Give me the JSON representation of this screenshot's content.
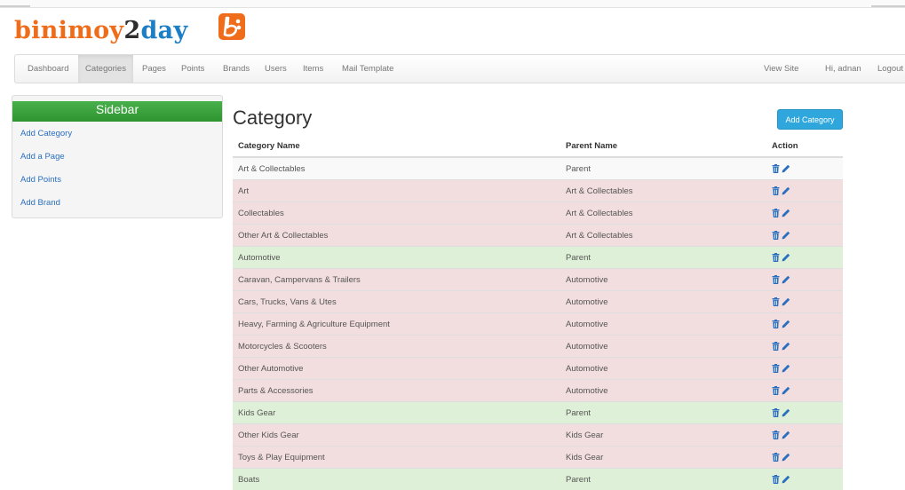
{
  "brand": {
    "part1": "binimoy",
    "part2": "2",
    "part3": "day"
  },
  "nav": {
    "left": [
      "Dashboard",
      "Categories",
      "Pages",
      "Points",
      "Brands",
      "Users",
      "Items",
      "Mail Template"
    ],
    "active": "Categories",
    "right": [
      "View Site",
      "Hi, adnan",
      "Logout"
    ]
  },
  "sidebar": {
    "title": "Sidebar",
    "links": [
      "Add Category",
      "Add a Page",
      "Add Points",
      "Add Brand"
    ]
  },
  "main": {
    "title": "Category",
    "add_button": "Add Category",
    "columns": [
      "Category Name",
      "Parent Name",
      "Action"
    ],
    "rows": [
      {
        "name": "Art & Collectables",
        "parent": "Parent",
        "style": "plain"
      },
      {
        "name": "Art",
        "parent": "Art & Collectables",
        "style": "child"
      },
      {
        "name": "Collectables",
        "parent": "Art & Collectables",
        "style": "child"
      },
      {
        "name": "Other Art & Collectables",
        "parent": "Art & Collectables",
        "style": "child"
      },
      {
        "name": "Automotive",
        "parent": "Parent",
        "style": "parent"
      },
      {
        "name": "Caravan, Campervans & Trailers",
        "parent": "Automotive",
        "style": "child"
      },
      {
        "name": "Cars, Trucks, Vans & Utes",
        "parent": "Automotive",
        "style": "child"
      },
      {
        "name": "Heavy, Farming & Agriculture Equipment",
        "parent": "Automotive",
        "style": "child"
      },
      {
        "name": "Motorcycles & Scooters",
        "parent": "Automotive",
        "style": "child"
      },
      {
        "name": "Other Automotive",
        "parent": "Automotive",
        "style": "child"
      },
      {
        "name": "Parts & Accessories",
        "parent": "Automotive",
        "style": "child"
      },
      {
        "name": "Kids Gear",
        "parent": "Parent",
        "style": "parent"
      },
      {
        "name": "Other Kids Gear",
        "parent": "Kids Gear",
        "style": "child"
      },
      {
        "name": "Toys & Play Equipment",
        "parent": "Kids Gear",
        "style": "child"
      },
      {
        "name": "Boats",
        "parent": "Parent",
        "style": "parent"
      }
    ],
    "action_icons": [
      "trash-icon",
      "pencil-icon"
    ]
  },
  "colors": {
    "brand_orange": "#ef6c1b",
    "brand_blue": "#1c7ec4",
    "sidebar_green": "#3aa23c",
    "button_blue": "#2fa7dc",
    "parent_row": "#dff0d8",
    "child_row": "#f2dede",
    "link": "#2a6fbf"
  }
}
